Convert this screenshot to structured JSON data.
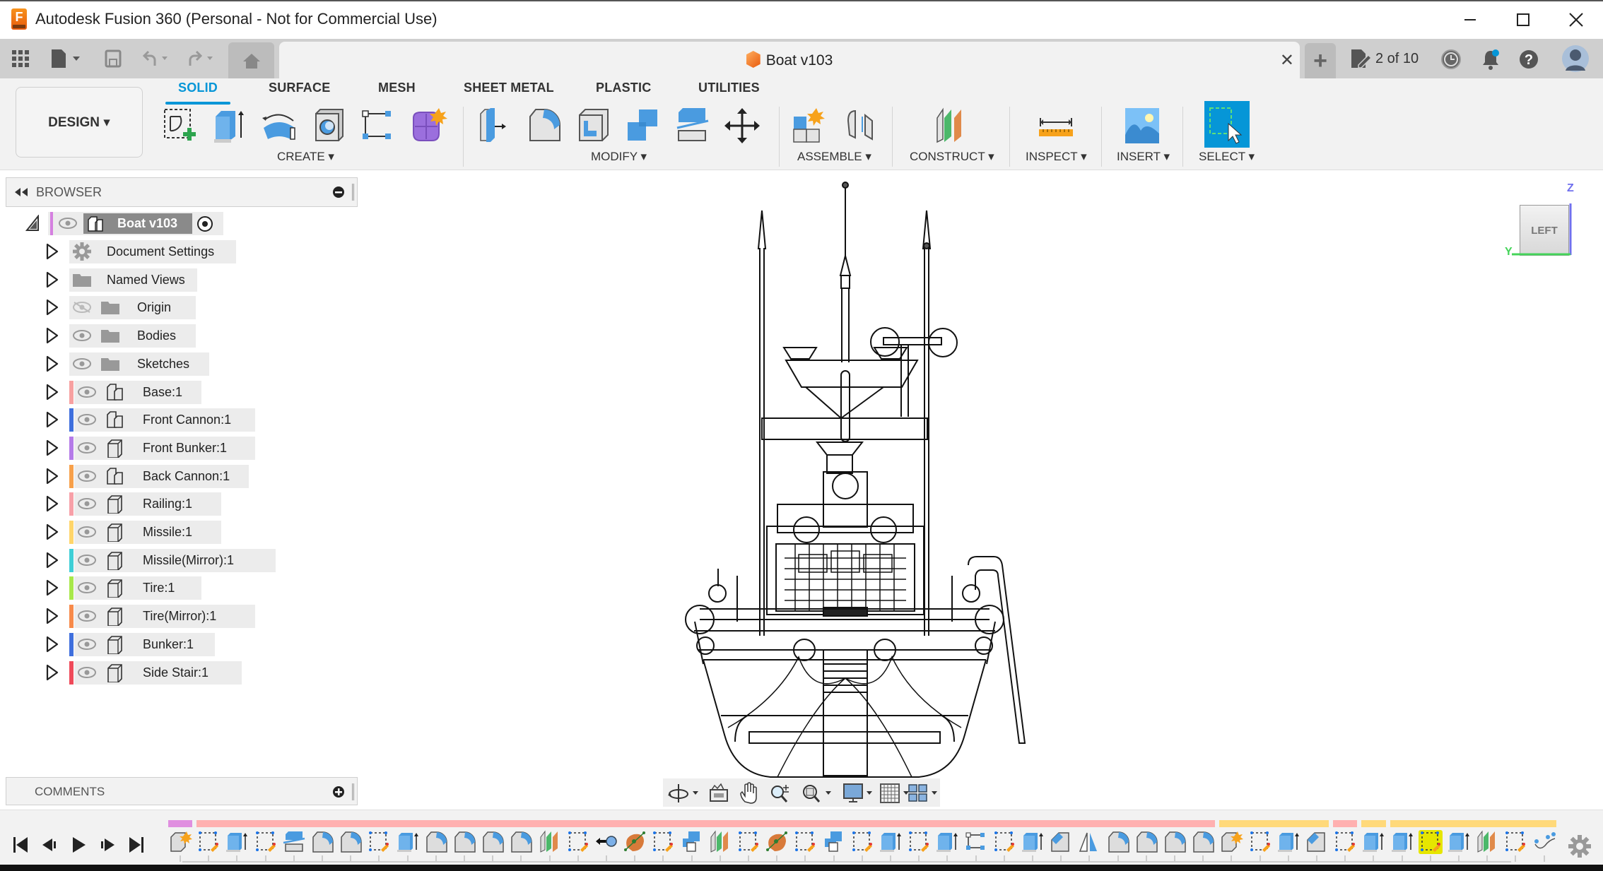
{
  "window": {
    "title": "Autodesk Fusion 360 (Personal - Not for Commercial Use)",
    "app_icon_letter": "F",
    "minimize_label": "—",
    "maximize_label": "☐",
    "close_label": "✕"
  },
  "tabbar": {
    "document_title": "Boat v103",
    "close_tab_label": "✕",
    "new_tab_label": "+",
    "jobs_status": "2 of 10",
    "notification_dot_color": "#0696d7"
  },
  "ribbon": {
    "workspace": "DESIGN ▾",
    "tabs": [
      {
        "label": "SOLID",
        "active": true
      },
      {
        "label": "SURFACE",
        "active": false
      },
      {
        "label": "MESH",
        "active": false
      },
      {
        "label": "SHEET METAL",
        "active": false
      },
      {
        "label": "PLASTIC",
        "active": false
      },
      {
        "label": "UTILITIES",
        "active": false
      }
    ],
    "groups": [
      {
        "label": "CREATE ▾",
        "tools": [
          "create-sketch",
          "extrude",
          "revolve",
          "hole",
          "rectangular-pattern",
          "create-form"
        ]
      },
      {
        "label": "MODIFY ▾",
        "tools": [
          "press-pull",
          "fillet",
          "shell",
          "combine",
          "split-body",
          "move-copy"
        ]
      },
      {
        "label": "ASSEMBLE ▾",
        "tools": [
          "new-component",
          "joint"
        ]
      },
      {
        "label": "CONSTRUCT ▾",
        "tools": [
          "offset-plane"
        ]
      },
      {
        "label": "INSPECT ▾",
        "tools": [
          "measure"
        ]
      },
      {
        "label": "INSERT ▾",
        "tools": [
          "insert-canvas"
        ]
      },
      {
        "label": "SELECT ▾",
        "tools": [
          "window-select"
        ]
      }
    ],
    "accent_color": "#0696d7"
  },
  "browser": {
    "header": "BROWSER",
    "root": {
      "label": "Boat v103",
      "color": "#d580e0"
    },
    "folders": [
      {
        "label": "Document Settings",
        "icon": "gear-icon",
        "visible": null
      },
      {
        "label": "Named Views",
        "icon": "folder-icon",
        "visible": null
      },
      {
        "label": "Origin",
        "icon": "folder-icon",
        "visible": false
      },
      {
        "label": "Bodies",
        "icon": "folder-icon",
        "visible": true
      },
      {
        "label": "Sketches",
        "icon": "folder-icon",
        "visible": true
      }
    ],
    "components": [
      {
        "label": "Base:1",
        "color": "#f7a0a0",
        "icon": "component-multi-icon"
      },
      {
        "label": "Front Cannon:1",
        "color": "#3f6fdd",
        "icon": "component-multi-icon"
      },
      {
        "label": "Front Bunker:1",
        "color": "#b57be8",
        "icon": "component-icon"
      },
      {
        "label": "Back Cannon:1",
        "color": "#f7a04a",
        "icon": "component-multi-icon"
      },
      {
        "label": "Railing:1",
        "color": "#f7a0a8",
        "icon": "component-icon"
      },
      {
        "label": "Missile:1",
        "color": "#ffd56a",
        "icon": "component-icon"
      },
      {
        "label": "Missile(Mirror):1",
        "color": "#3fcfd6",
        "icon": "component-icon"
      },
      {
        "label": "Tire:1",
        "color": "#a8e84a",
        "icon": "component-icon"
      },
      {
        "label": "Tire(Mirror):1",
        "color": "#f78a4a",
        "icon": "component-icon"
      },
      {
        "label": "Bunker:1",
        "color": "#3f6fdd",
        "icon": "component-icon"
      },
      {
        "label": "Side Stair:1",
        "color": "#ef4a5a",
        "icon": "component-icon"
      }
    ]
  },
  "comments": {
    "header": "COMMENTS"
  },
  "viewcube": {
    "face": "LEFT",
    "axis_z": "Z",
    "axis_y": "Y"
  },
  "navbar": {
    "tools": [
      "orbit",
      "look-at",
      "pan",
      "zoom",
      "fit",
      "display-settings",
      "grid-snaps",
      "viewports"
    ]
  },
  "timeline": {
    "controls": [
      "first",
      "previous",
      "play",
      "next",
      "last"
    ],
    "features": [
      "component",
      "sketch",
      "extrude",
      "sketch",
      "split",
      "fillet",
      "fillet",
      "sketch",
      "extrude",
      "fillet",
      "fillet",
      "fillet",
      "fillet",
      "plane",
      "sketch",
      "joint",
      "form",
      "sketch",
      "combine",
      "plane",
      "sketch",
      "form",
      "sketch",
      "combine",
      "sketch",
      "extrude",
      "sketch",
      "extrude",
      "pattern",
      "sketch",
      "extrude",
      "chamfer",
      "mirror",
      "fillet",
      "fillet",
      "fillet",
      "fillet",
      "component",
      "sketch",
      "extrude",
      "chamfer",
      "sketch",
      "extrude",
      "extrude",
      "sketch",
      "extrude",
      "plane",
      "sketch",
      "path"
    ],
    "active_feature_index": 44,
    "group_bars": [
      {
        "color": "#e08fe0",
        "start": 0,
        "end": 1
      },
      {
        "color": "#ffb0b0",
        "start": 1,
        "end": 37
      },
      {
        "color": "#ffd97a",
        "start": 37,
        "end": 41
      },
      {
        "color": "#ffb0b0",
        "start": 41,
        "end": 42
      },
      {
        "color": "#ffd97a",
        "start": 42,
        "end": 43
      },
      {
        "color": "#ffd97a",
        "start": 43,
        "end": 49
      }
    ],
    "highlight_color": "#e6e600"
  }
}
